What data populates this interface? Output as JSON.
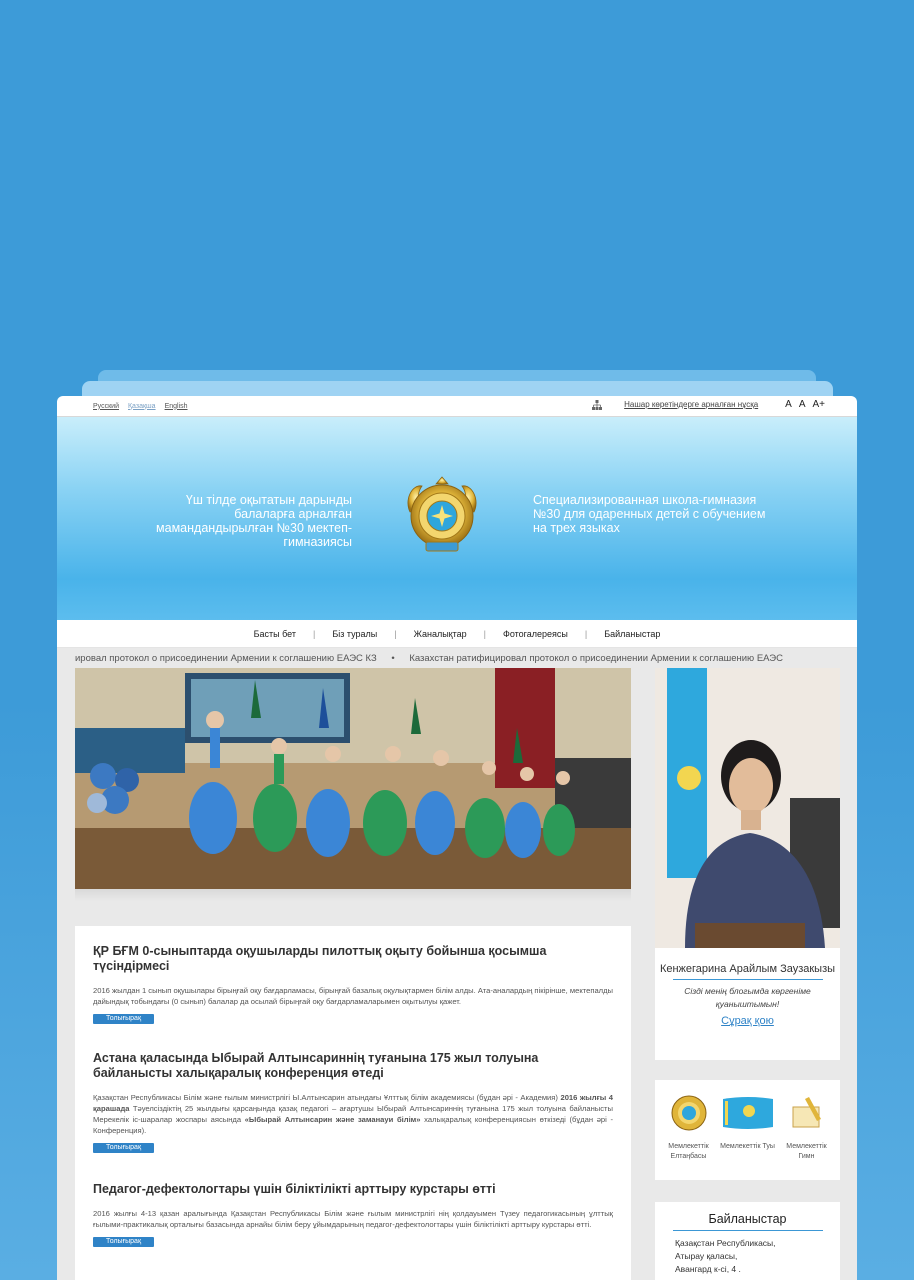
{
  "topbar": {
    "languages": [
      "Русский",
      "Қазақша",
      "English"
    ],
    "accessible_version": "Нашар көретіндерге арналған нұсқа",
    "font_sizes": [
      "A",
      "A",
      "A+"
    ],
    "sitemap_icon": "sitemap-icon"
  },
  "header": {
    "title_kz": "Үш тілде оқытатын дарынды балаларға арналған мамандандырылған №30 мектеп-гимназиясы",
    "title_ru": "Специализированная школа-гимназия №30 для одаренных детей с обучением на трех языках",
    "emblem_icon": "kazakhstan-emblem-icon"
  },
  "nav": {
    "items": [
      "Басты бет",
      "Біз туралы",
      "Жаналықтар",
      "Фотогалереясы",
      "Байланыстар"
    ]
  },
  "ticker": {
    "item1": "ировал протокол о присоединении Армении к соглашению ЕАЭС КЗ",
    "item2": "Казахстан ратифицировал протокол о присоединении Армении к соглашению ЕАЭС"
  },
  "news": [
    {
      "title": "ҚР БҒМ 0-сыныптарда оқушыларды пилоттық оқыту бойынша қосымша түсіндірмесі",
      "text": "2016 жылдан 1 сынып оқушылары бірыңғай оқу бағдарламасы, бірыңғай базалық оқулықтармен білім алды. Ата-аналардың пікірінше, мектепалды дайындық тобындағы (0 сынып) балалар да осылай бірыңғай оқу бағдарламаларымен оқытылуы қажет.",
      "more": "Толығырақ"
    },
    {
      "title": "Астана қаласында Ыбырай Алтынсариннің туғанына 175 жыл толуына байланысты халықаралық конференция өтеді",
      "text_a": "Қазақстан Республикасы Білім және ғылым министрлігі Ы.Алтынсарин атындағы Ұлттық білім академиясы (бұдан әрі - Академия) ",
      "text_b": "2016 жылғы 4 қарашада",
      "text_c": " Тәуелсіздіктің 25 жылдығы қарсаңында қазақ педагогі – ағартушы Ыбырай Алтынсариннің туғанына 175 жыл толуына байланысты Мерекелік іс-шаралар жоспары аясында ",
      "text_d": "«Ыбырай Алтынсарин және заманауи білім»",
      "text_e": " халықаралық конференциясын өткізеді (бұдан әрі - Конференция).",
      "more": "Толығырақ"
    },
    {
      "title": "Педагог-дефектологтары үшін біліктілікті арттыру курстары өтті",
      "text": "2016 жылғы 4-13 қазан аралығында Қазақстан Республикасы Білім және ғылым министрлігі нің қолдауымен Түзеу педагогикасының ұлттық ғылыми-практикалық орталығы базасында арнайы білім беру ұйымдарының педагог-дефектологтары үшін біліктілікті арттыру курстары өтті.",
      "more": "Толығырақ"
    }
  ],
  "director": {
    "name": "Кенжегарина Арайлым Заузакызы",
    "quote": "Сізді менің блогымда көргеніме қуаныштымын!",
    "ask": "Сұрақ қою"
  },
  "symbols": [
    {
      "icon": "emblem-icon",
      "label": "Мемлекеттік Елтаңбасы"
    },
    {
      "icon": "flag-icon",
      "label": "Мемлекеттік Туы"
    },
    {
      "icon": "anthem-icon",
      "label": "Мемлекеттік Гимн"
    }
  ],
  "contacts": {
    "title": "Байланыстар",
    "lines": [
      "Қазақстан Республикасы,",
      "Атырау қаласы,",
      "Авангард к-сі, 4 ."
    ]
  }
}
